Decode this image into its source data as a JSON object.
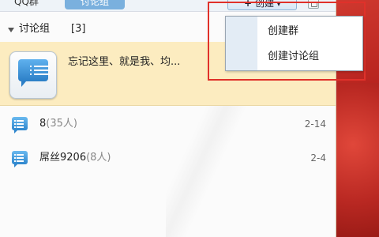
{
  "tabs": {
    "qq_group": "QQ群",
    "discussion": "讨论组"
  },
  "toolbar": {
    "create_label": "创建",
    "create_caret": "▾",
    "create_plus": "+"
  },
  "group": {
    "title": "讨论组",
    "count": "[3]"
  },
  "selected": {
    "name": "忘记这里、就是我、均..."
  },
  "rows": [
    {
      "name": "8",
      "members": "(35人)",
      "date": "2-14"
    },
    {
      "name": "屌丝9206",
      "members": "(8人)",
      "date": "2-4"
    }
  ],
  "menu": {
    "items": [
      "创建群",
      "创建讨论组"
    ]
  },
  "colors": {
    "accent": "#7ab0de",
    "selected_bg": "#fcecc0",
    "highlight_border": "#e0312a"
  }
}
